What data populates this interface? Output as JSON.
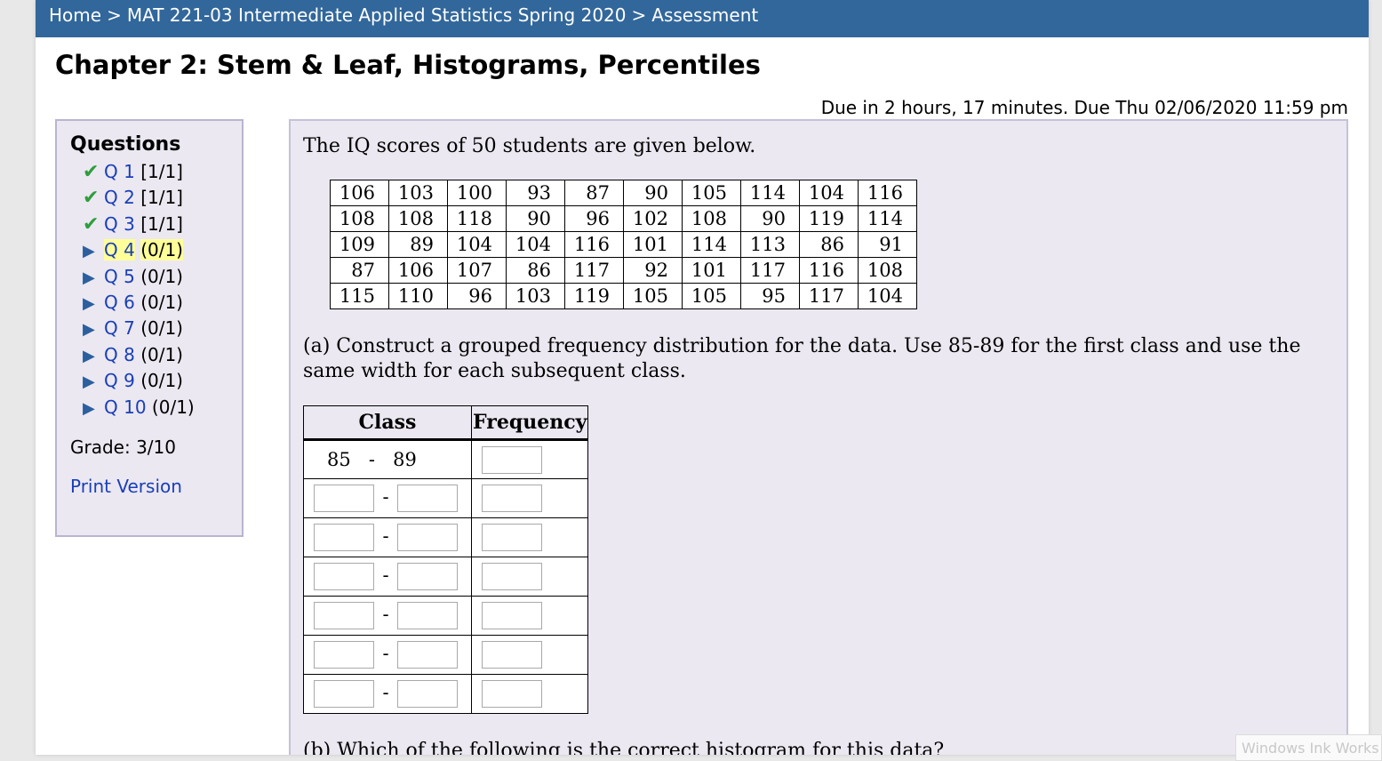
{
  "breadcrumb": {
    "home": "Home",
    "course": "MAT 221-03 Intermediate Applied Statistics Spring 2020",
    "current": "Assessment",
    "separator": ">"
  },
  "title": "Chapter 2: Stem & Leaf, Histograms, Percentiles",
  "due": "Due in 2 hours, 17 minutes. Due Thu 02/06/2020 11:59 pm",
  "sidebar": {
    "heading": "Questions",
    "items": [
      {
        "label": "Q 1",
        "score": "[1/1]",
        "status": "check-icon"
      },
      {
        "label": "Q 2",
        "score": "[1/1]",
        "status": "check-icon"
      },
      {
        "label": "Q 3",
        "score": "[1/1]",
        "status": "check-icon"
      },
      {
        "label": "Q 4",
        "score": "(0/1)",
        "status": "play-triangle-icon"
      },
      {
        "label": "Q 5",
        "score": "(0/1)",
        "status": "play-triangle-icon"
      },
      {
        "label": "Q 6",
        "score": "(0/1)",
        "status": "play-triangle-icon"
      },
      {
        "label": "Q 7",
        "score": "(0/1)",
        "status": "play-triangle-icon"
      },
      {
        "label": "Q 8",
        "score": "(0/1)",
        "status": "play-triangle-icon"
      },
      {
        "label": "Q 9",
        "score": "(0/1)",
        "status": "play-triangle-icon"
      },
      {
        "label": "Q 10",
        "score": "(0/1)",
        "status": "play-triangle-icon"
      }
    ],
    "grade": "Grade: 3/10",
    "print": "Print Version"
  },
  "question": {
    "intro": "The IQ scores of 50 students are given below.",
    "scores": [
      [
        "106",
        "103",
        "100",
        "93",
        "87",
        "90",
        "105",
        "114",
        "104",
        "116"
      ],
      [
        "108",
        "108",
        "118",
        "90",
        "96",
        "102",
        "108",
        "90",
        "119",
        "114"
      ],
      [
        "109",
        "89",
        "104",
        "104",
        "116",
        "101",
        "114",
        "113",
        "86",
        "91"
      ],
      [
        "87",
        "106",
        "107",
        "86",
        "117",
        "92",
        "101",
        "117",
        "116",
        "108"
      ],
      [
        "115",
        "110",
        "96",
        "103",
        "119",
        "105",
        "105",
        "95",
        "117",
        "104"
      ]
    ],
    "part_a": "(a) Construct a grouped frequency distribution for the data. Use 85-89 for the first class and use the same width for each subsequent class.",
    "freq_table": {
      "col_class": "Class",
      "col_freq": "Frequency",
      "first_lower": "85",
      "first_upper": "89",
      "dash": "-",
      "blank_rows": 6
    },
    "part_b": "(b) Which of the following is the correct histogram for this data?"
  },
  "overlay": {
    "ink": "Windows Ink Works"
  },
  "colors": {
    "header": "#32679b",
    "panel": "#ebe8f1",
    "link": "#1a3fb8",
    "check": "#2e9e3c",
    "highlight": "#ffff99"
  }
}
